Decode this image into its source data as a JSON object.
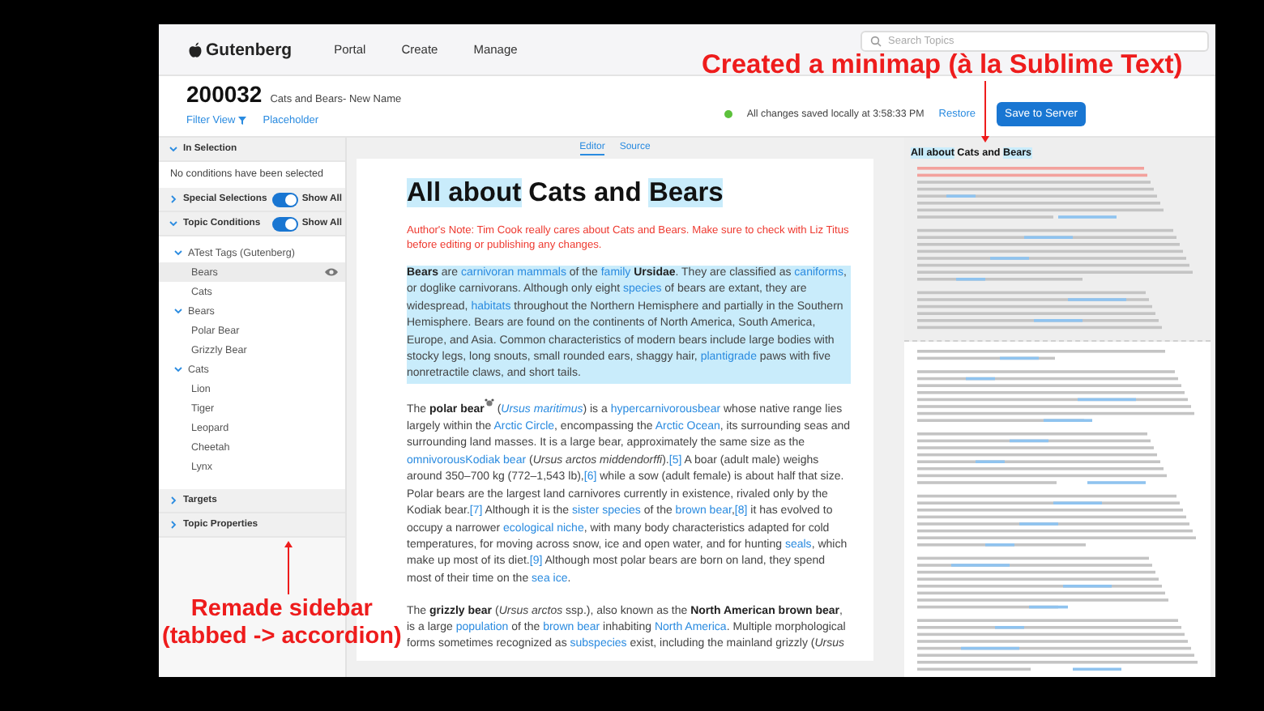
{
  "nav": {
    "logo": "Gutenberg",
    "items": [
      "Portal",
      "Create",
      "Manage"
    ],
    "search": {
      "placeholder": "Search Topics"
    }
  },
  "header": {
    "topic_id": "200032",
    "topic_name": "Cats and Bears- New Name",
    "links": [
      "Filter View",
      "Placeholder"
    ],
    "status": {
      "color": "#5cc13c",
      "text": "All changes saved locally at 3:58:33 PM"
    },
    "restore": "Restore",
    "save": "Save to Server"
  },
  "sidebar": {
    "sections": [
      {
        "title": "In Selection",
        "expanded": true,
        "kind": "message",
        "message": "No conditions have been selected"
      },
      {
        "title": "Special Selections",
        "expanded": false,
        "toggle": {
          "on": true,
          "label": "Show All"
        }
      },
      {
        "title": "Topic Conditions",
        "expanded": true,
        "kind": "tree",
        "toggle": {
          "on": true,
          "label": "Show All"
        },
        "tree": [
          {
            "label": "ATest Tags (Gutenberg)",
            "expanded": true,
            "children": [
              {
                "label": "Bears",
                "selected": true
              },
              {
                "label": "Cats",
                "selected": false
              }
            ]
          },
          {
            "label": "Bears",
            "expanded": true,
            "children": [
              {
                "label": "Polar Bear",
                "selected": false
              },
              {
                "label": "Grizzly Bear",
                "selected": false
              }
            ]
          },
          {
            "label": "Cats",
            "expanded": true,
            "children": [
              {
                "label": "Lion",
                "selected": false
              },
              {
                "label": "Tiger",
                "selected": false
              },
              {
                "label": "Leopard",
                "selected": false
              },
              {
                "label": "Cheetah",
                "selected": false
              },
              {
                "label": "Lynx",
                "selected": false
              }
            ]
          }
        ]
      },
      {
        "title": "Targets",
        "expanded": false
      },
      {
        "title": "Topic Properties",
        "expanded": false
      }
    ]
  },
  "editor": {
    "tabs": [
      {
        "label": "Editor",
        "selected": true
      },
      {
        "label": "Source",
        "selected": false
      }
    ],
    "title": [
      {
        "text": "All about",
        "highlighted": true
      },
      {
        "text": " Cats and ",
        "highlighted": false
      },
      {
        "text": "Bears",
        "highlighted": true
      }
    ],
    "note": "Author's Note: Tim Cook really cares about Cats and Bears. Make sure to check with Liz Titus before editing or publishing any changes.",
    "paragraphs": [
      {
        "highlighted": true,
        "segments": [
          {
            "text": "Bears",
            "kind": "bold"
          },
          {
            "text": " are ",
            "kind": "plain"
          },
          {
            "text": "carnivoran mammals",
            "kind": "link"
          },
          {
            "text": " of the ",
            "kind": "plain"
          },
          {
            "text": "family",
            "kind": "link"
          },
          {
            "text": " Ursidae",
            "kind": "bold"
          },
          {
            "text": ". They are classified as ",
            "kind": "plain"
          },
          {
            "text": "caniforms",
            "kind": "link"
          },
          {
            "text": ", or doglike carnivorans. Although only eight ",
            "kind": "plain"
          },
          {
            "text": "species",
            "kind": "link"
          },
          {
            "text": " of bears are extant, they are widespread, ",
            "kind": "plain"
          },
          {
            "text": "habitats",
            "kind": "link"
          },
          {
            "text": " throughout the Northern Hemisphere and partially in the Southern Hemisphere. Bears are found on the continents of North America, South America, Europe, and Asia. Common characteristics of modern bears include large bodies with stocky legs, long snouts, small rounded ears, shaggy hair, ",
            "kind": "plain"
          },
          {
            "text": "plantigrade",
            "kind": "link"
          },
          {
            "text": " paws with five nonretractile claws, and short tails.",
            "kind": "plain"
          }
        ]
      },
      {
        "highlighted": false,
        "segments": [
          {
            "text": "The ",
            "kind": "plain"
          },
          {
            "text": "polar bear",
            "kind": "bold"
          },
          {
            "kind": "icon"
          },
          {
            "text": " (",
            "kind": "plain"
          },
          {
            "text": "Ursus maritimus",
            "kind": "italic-link"
          },
          {
            "text": ") is a ",
            "kind": "plain"
          },
          {
            "text": "hypercarnivorousbear",
            "kind": "link"
          },
          {
            "text": " whose native range lies largely within the ",
            "kind": "plain"
          },
          {
            "text": "Arctic Circle",
            "kind": "link"
          },
          {
            "text": ", encompassing the ",
            "kind": "plain"
          },
          {
            "text": "Arctic Ocean",
            "kind": "link"
          },
          {
            "text": ", its surrounding seas and surrounding land masses. It is a large bear, approximately the same size as the ",
            "kind": "plain"
          },
          {
            "text": "omnivorousKodiak bear",
            "kind": "link"
          },
          {
            "text": " (",
            "kind": "plain"
          },
          {
            "text": "Ursus arctos middendorffi",
            "kind": "italic"
          },
          {
            "text": ").",
            "kind": "plain"
          },
          {
            "text": "[5]",
            "kind": "link"
          },
          {
            "text": " A boar (adult male) weighs around 350–700 kg (772–1,543 lb),",
            "kind": "plain"
          },
          {
            "text": "[6]",
            "kind": "link"
          },
          {
            "text": " while a sow (adult female) is about half that size. Polar bears are the largest land carnivores currently in existence, rivaled only by the Kodiak bear.",
            "kind": "plain"
          },
          {
            "text": "[7]",
            "kind": "link"
          },
          {
            "text": " Although it is the ",
            "kind": "plain"
          },
          {
            "text": "sister species",
            "kind": "link"
          },
          {
            "text": " of the ",
            "kind": "plain"
          },
          {
            "text": "brown bear",
            "kind": "link"
          },
          {
            "text": ",",
            "kind": "plain"
          },
          {
            "text": "[8]",
            "kind": "link"
          },
          {
            "text": " it has evolved to occupy a narrower ",
            "kind": "plain"
          },
          {
            "text": "ecological niche",
            "kind": "link"
          },
          {
            "text": ", with many body characteristics adapted for cold temperatures, for moving across snow, ice and open water, and for hunting ",
            "kind": "plain"
          },
          {
            "text": "seals",
            "kind": "link"
          },
          {
            "text": ", which make up most of its diet.",
            "kind": "plain"
          },
          {
            "text": "[9]",
            "kind": "link"
          },
          {
            "text": " Although most polar bears are born on land, they spend most of their time on the ",
            "kind": "plain"
          },
          {
            "text": "sea ice",
            "kind": "link"
          },
          {
            "text": ".",
            "kind": "plain"
          }
        ]
      },
      {
        "highlighted": false,
        "segments": [
          {
            "text": "The ",
            "kind": "plain"
          },
          {
            "text": "grizzly bear",
            "kind": "bold"
          },
          {
            "text": " (",
            "kind": "plain"
          },
          {
            "text": "Ursus arctos",
            "kind": "italic"
          },
          {
            "text": " ssp.), also known as the ",
            "kind": "plain"
          },
          {
            "text": "North American brown bear",
            "kind": "bold"
          },
          {
            "text": ", is a large ",
            "kind": "plain"
          },
          {
            "text": "population",
            "kind": "link"
          },
          {
            "text": " of the ",
            "kind": "plain"
          },
          {
            "text": "brown bear",
            "kind": "link"
          },
          {
            "text": " inhabiting ",
            "kind": "plain"
          },
          {
            "text": "North America",
            "kind": "link"
          },
          {
            "text": ". Multiple morphological forms sometimes recognized as ",
            "kind": "plain"
          },
          {
            "text": "subspecies",
            "kind": "link"
          },
          {
            "text": " exist, including the mainland grizzly (",
            "kind": "plain"
          },
          {
            "text": "Ursus",
            "kind": "italic"
          }
        ]
      }
    ]
  },
  "minimap": {
    "title": [
      {
        "text": "All about",
        "highlighted": true
      },
      {
        "text": " Cats and ",
        "highlighted": false
      },
      {
        "text": "Bears",
        "highlighted": true
      }
    ]
  },
  "annotations": [
    {
      "lines": [
        "Created a minimap (à la Sublime Text)"
      ]
    },
    {
      "lines": [
        "Remade sidebar",
        "(tabbed -> accordion)"
      ]
    }
  ]
}
